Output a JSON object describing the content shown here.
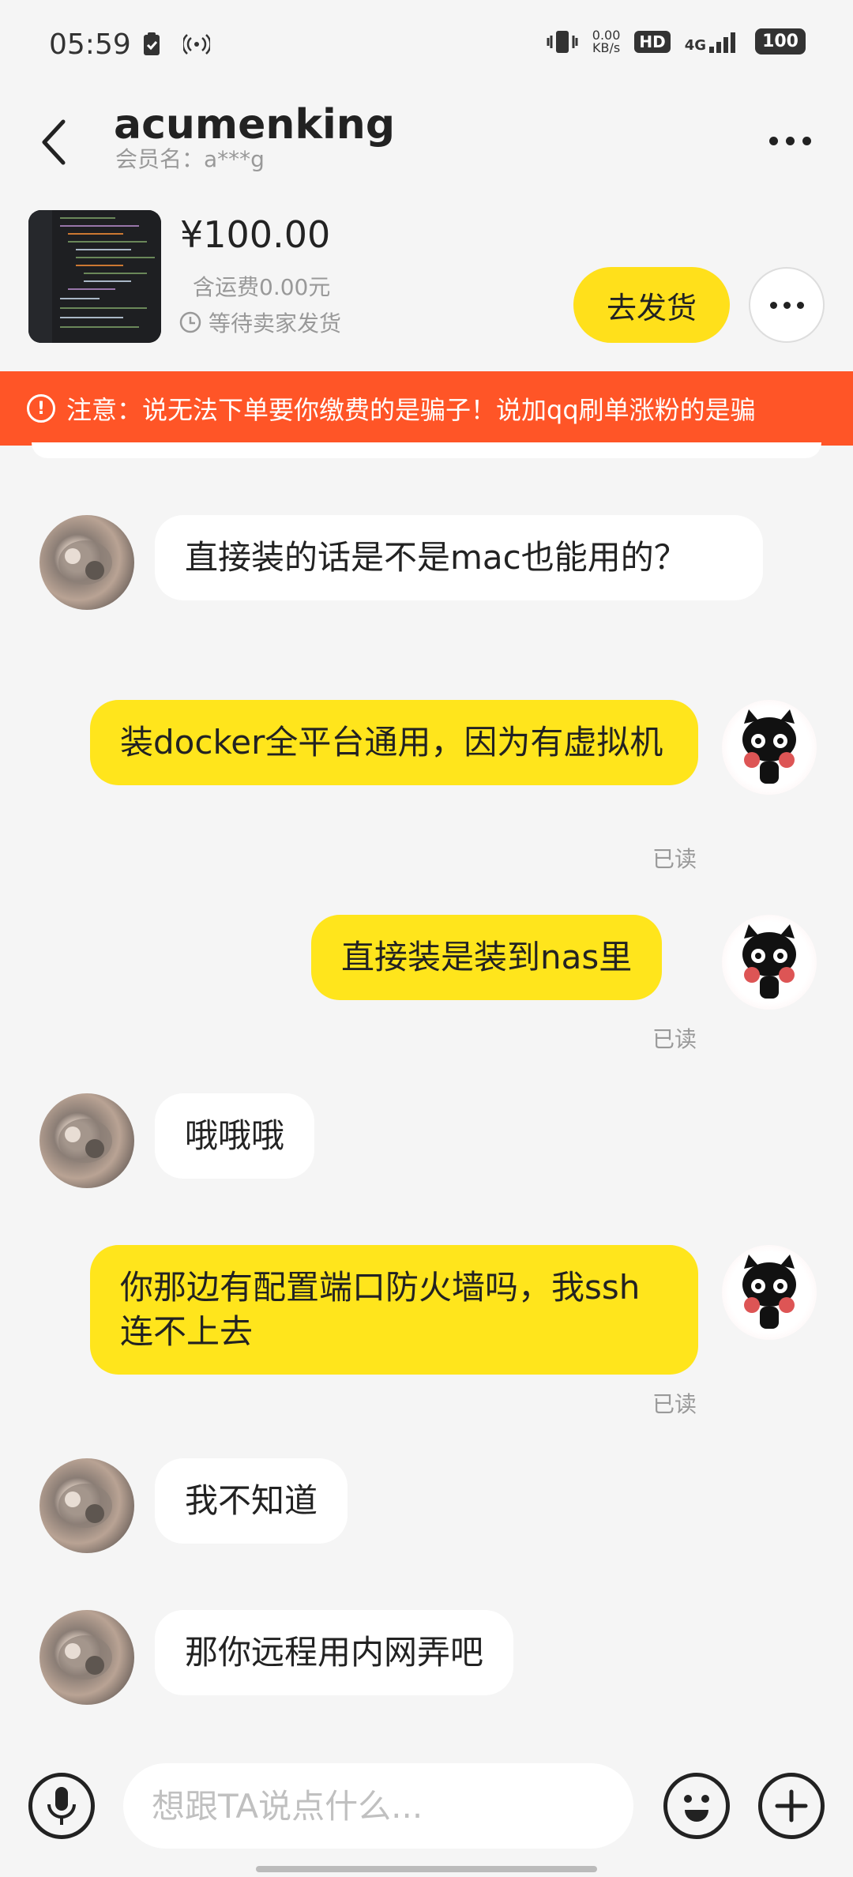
{
  "status_bar": {
    "time": "05:59",
    "speed_value": "0.00",
    "speed_unit": "KB/s",
    "hd_label": "HD",
    "network_label": "4G",
    "battery": "100"
  },
  "header": {
    "title": "acumenking",
    "member_label": "会员名：a***g"
  },
  "product": {
    "price": "¥100.00",
    "shipping": "含运费0.00元",
    "status": "等待卖家发货",
    "ship_button": "去发货"
  },
  "warning": {
    "text": "注意：说无法下单要你缴费的是骗子！说加qq刷单涨粉的是骗"
  },
  "messages": [
    {
      "from": "other",
      "text": "直接装的话是不是mac也能用的？"
    },
    {
      "from": "me",
      "text": "装docker全平台通用，因为有虚拟机",
      "read": "已读"
    },
    {
      "from": "me",
      "text": "直接装是装到nas里",
      "read": "已读"
    },
    {
      "from": "other",
      "text": "哦哦哦"
    },
    {
      "from": "me",
      "text": "你那边有配置端口防火墙吗，我ssh连不上去",
      "read": "已读"
    },
    {
      "from": "other",
      "text": "我不知道"
    },
    {
      "from": "other",
      "text": "那你远程用内网弄吧"
    }
  ],
  "input": {
    "placeholder": "想跟TA说点什么..."
  },
  "colors": {
    "accent_yellow": "#ffe51c",
    "warning_red": "#ff5527",
    "background": "#f5f5f5"
  },
  "icons": [
    "back-arrow-icon",
    "more-icon",
    "clock-icon",
    "warning-icon",
    "microphone-icon",
    "emoji-icon",
    "plus-icon"
  ]
}
